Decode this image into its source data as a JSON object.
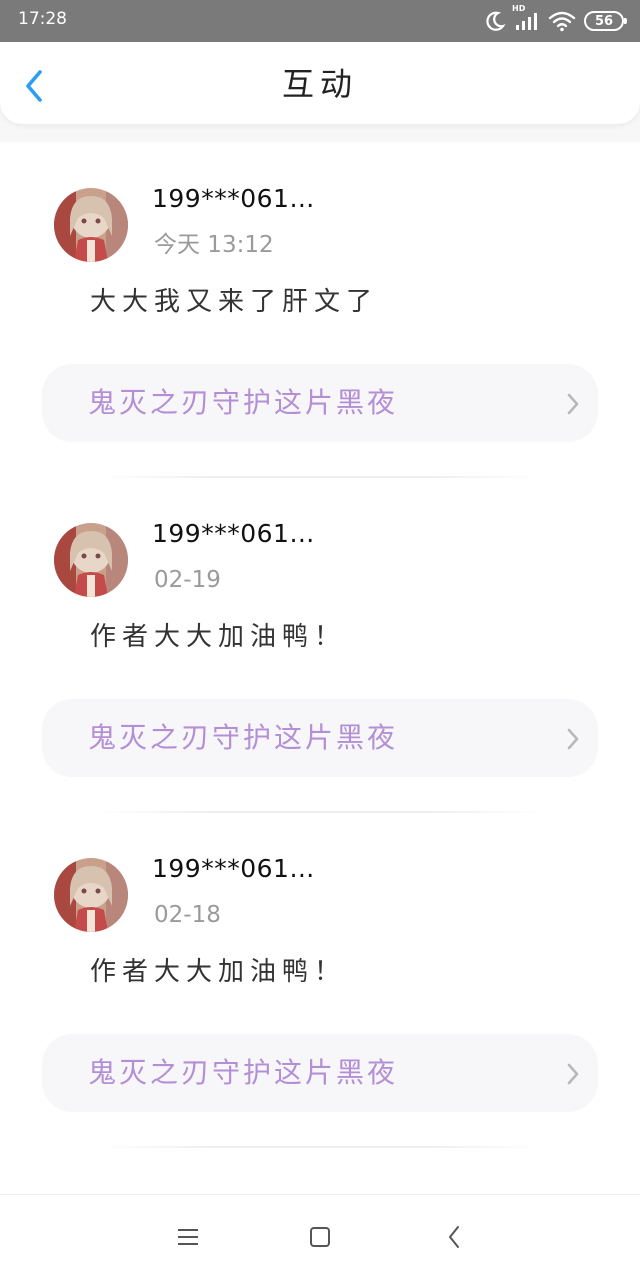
{
  "status_bar": {
    "time": "17:28",
    "network_label": "HD",
    "battery": "56",
    "icons": [
      "moon-icon",
      "signal-icon",
      "wifi-icon",
      "battery-icon"
    ]
  },
  "header": {
    "title": "互动",
    "back_icon": "chevron-left-icon"
  },
  "colors": {
    "accent": "#2a9df4",
    "book_title": "#b48fd6",
    "username": "#111111",
    "time": "#9a9a9a",
    "card_bg": "#f7f7f9"
  },
  "comments": [
    {
      "username": "199***061…",
      "time": "今天 13:12",
      "text": "大大我又来了肝文了",
      "book_title": "鬼灭之刃守护这片黑夜"
    },
    {
      "username": "199***061…",
      "time": "02-19",
      "text": "作者大大加油鸭！",
      "book_title": "鬼灭之刃守护这片黑夜"
    },
    {
      "username": "199***061…",
      "time": "02-18",
      "text": "作者大大加油鸭！",
      "book_title": "鬼灭之刃守护这片黑夜"
    }
  ],
  "nav_bar": {
    "icons": [
      "menu-icon",
      "home-icon",
      "back-icon"
    ]
  }
}
